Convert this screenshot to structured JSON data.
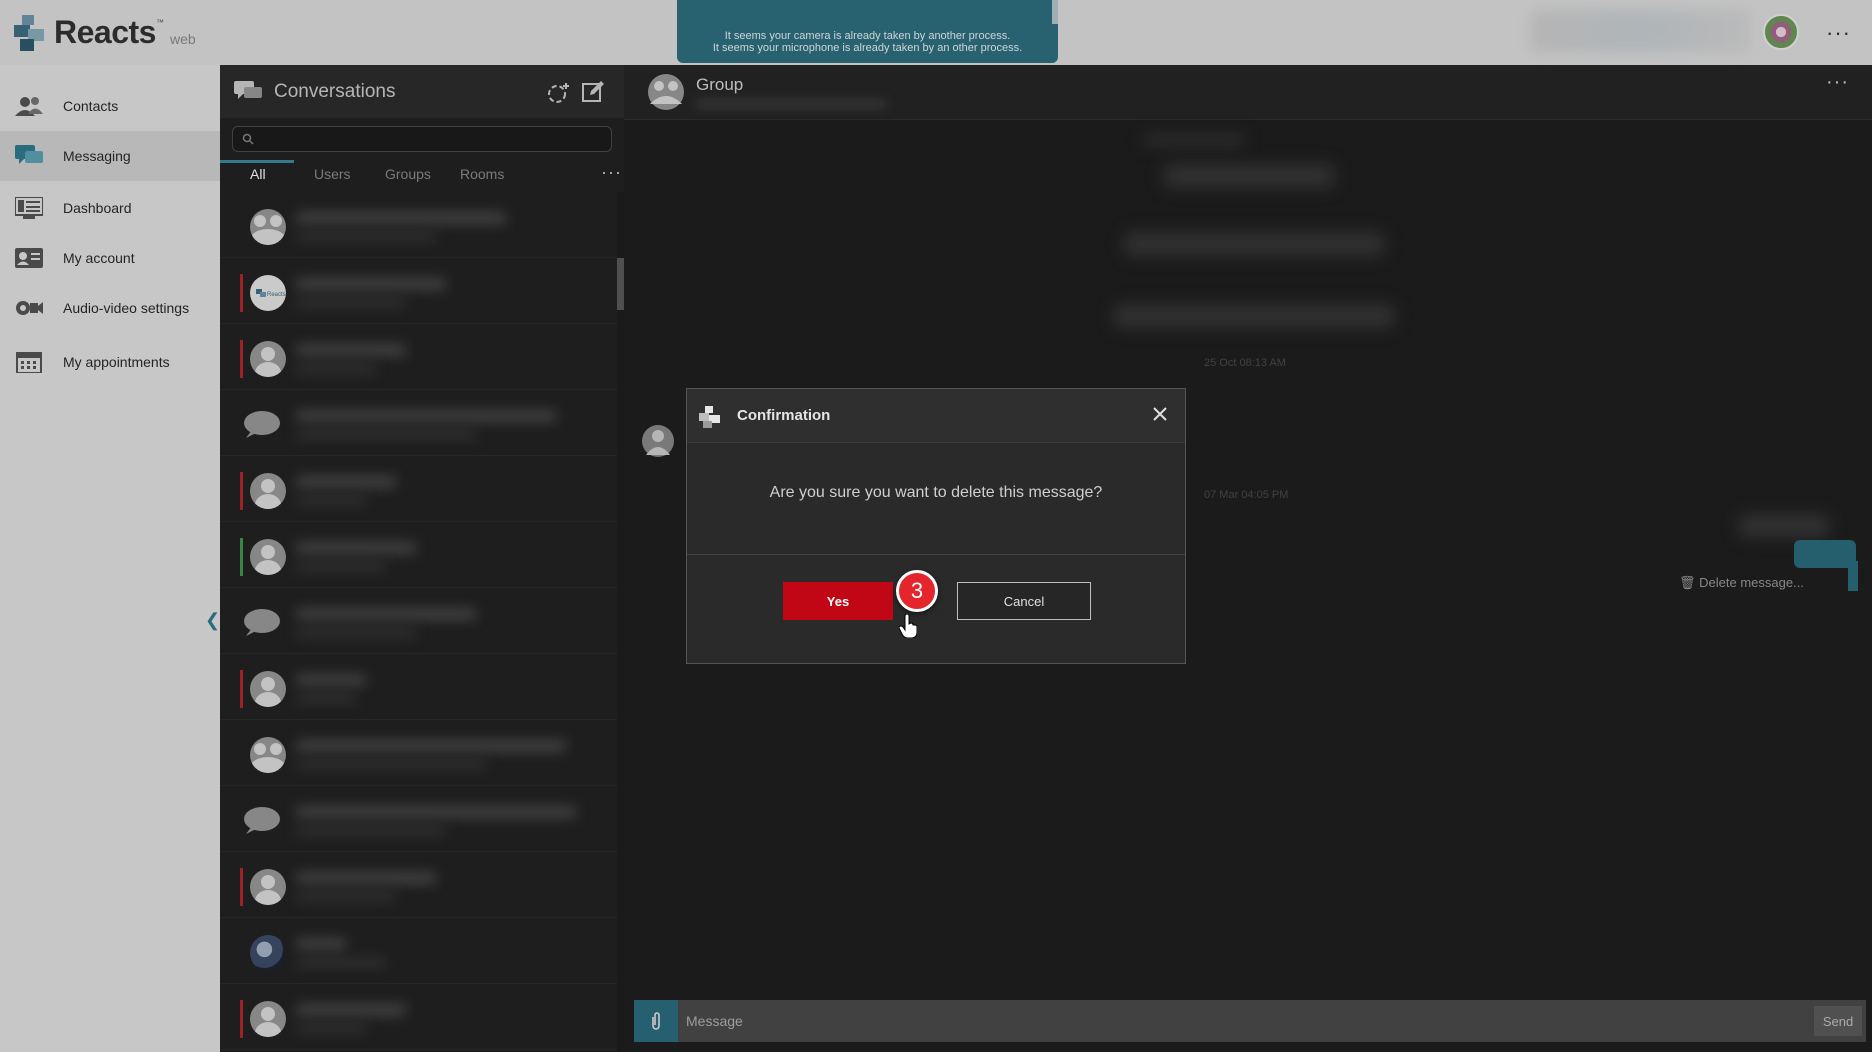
{
  "app": {
    "name": "Reacts",
    "suffix": "web",
    "tm": "™"
  },
  "notice": {
    "line1": "It seems your camera is already taken by another process.",
    "line2": "It seems your microphone is already taken by an other process."
  },
  "sidebar": {
    "items": [
      {
        "label": "Contacts",
        "icon": "contacts-icon"
      },
      {
        "label": "Messaging",
        "icon": "messaging-icon",
        "active": true
      },
      {
        "label": "Dashboard",
        "icon": "dashboard-icon"
      },
      {
        "label": "My account",
        "icon": "account-icon"
      },
      {
        "label": "Audio-video settings",
        "icon": "audio-video-icon"
      },
      {
        "label": "My appointments",
        "icon": "calendar-icon"
      }
    ],
    "collapse_glyph": "❮"
  },
  "conversations": {
    "title": "Conversations",
    "search_placeholder": "",
    "tabs": [
      {
        "label": "All",
        "active": true
      },
      {
        "label": "Users"
      },
      {
        "label": "Groups"
      },
      {
        "label": "Rooms"
      }
    ],
    "more": "···",
    "rows": [
      {
        "avatar": "group",
        "status": "none"
      },
      {
        "avatar": "reacts-logo",
        "status": "red"
      },
      {
        "avatar": "user",
        "status": "red"
      },
      {
        "avatar": "chat-bubble",
        "status": "none"
      },
      {
        "avatar": "user",
        "status": "red"
      },
      {
        "avatar": "user",
        "status": "green"
      },
      {
        "avatar": "chat-bubble",
        "status": "none"
      },
      {
        "avatar": "user",
        "status": "red"
      },
      {
        "avatar": "group",
        "status": "none"
      },
      {
        "avatar": "chat-bubble",
        "status": "none"
      },
      {
        "avatar": "user",
        "status": "red"
      },
      {
        "avatar": "photo",
        "status": "none"
      },
      {
        "avatar": "user",
        "status": "red"
      }
    ]
  },
  "chat": {
    "title": "Group",
    "more": "···",
    "timestamps": [
      "25 Oct 08:13 AM",
      "07 Mar 04:05 PM"
    ],
    "delete_message": "Delete message...",
    "input_placeholder": "Message",
    "send_label": "Send"
  },
  "modal": {
    "title": "Confirmation",
    "text": "Are you sure you want to delete this message?",
    "yes_label": "Yes",
    "cancel_label": "Cancel"
  },
  "annotation": {
    "step": "3"
  },
  "colors": {
    "accent": "#2e6f80",
    "danger": "#c10715",
    "badge": "#e4252c",
    "status_red": "#b3262c",
    "status_green": "#3f9a4a"
  }
}
